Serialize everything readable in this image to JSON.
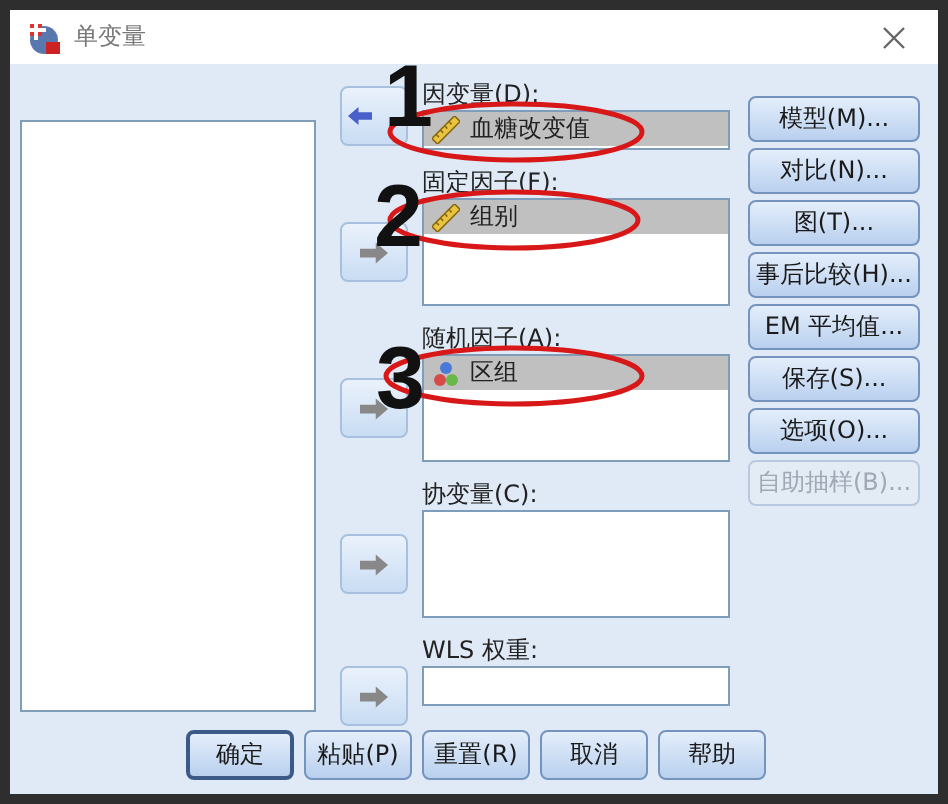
{
  "window": {
    "title": "单变量"
  },
  "groups": [
    {
      "label": "因变量(D):",
      "kind": "single",
      "arrow": {
        "kind": "left",
        "disabled": false
      },
      "items": [
        {
          "name": "血糖改变值",
          "kind": "scale",
          "selected": true
        }
      ]
    },
    {
      "label": "固定因子(F):",
      "kind": "list",
      "arrow": {
        "kind": "right",
        "disabled": true
      },
      "items": [
        {
          "name": "组别",
          "kind": "scale",
          "selected": true
        }
      ]
    },
    {
      "label": "随机因子(A):",
      "kind": "list",
      "arrow": {
        "kind": "right",
        "disabled": true
      },
      "items": [
        {
          "name": "区组",
          "kind": "nominal",
          "selected": true
        }
      ]
    },
    {
      "label": "协变量(C):",
      "kind": "list",
      "arrow": {
        "kind": "right",
        "disabled": true
      }
    },
    {
      "label": "WLS 权重:",
      "kind": "single",
      "arrow": {
        "kind": "right",
        "disabled": true
      }
    }
  ],
  "side_buttons": [
    {
      "label": "模型(M)...",
      "disabled": false
    },
    {
      "label": "对比(N)...",
      "disabled": false
    },
    {
      "label": "图(T)...",
      "disabled": false
    },
    {
      "label": "事后比较(H)...",
      "disabled": false
    },
    {
      "label": "EM 平均值...",
      "disabled": false
    },
    {
      "label": "保存(S)...",
      "disabled": false
    },
    {
      "label": "选项(O)...",
      "disabled": false
    },
    {
      "label": "自助抽样(B)...",
      "disabled": true
    }
  ],
  "bottom_buttons": [
    {
      "label": "确定",
      "default": true
    },
    {
      "label": "粘贴(P)",
      "default": false
    },
    {
      "label": "重置(R)",
      "default": false
    },
    {
      "label": "取消",
      "default": false
    },
    {
      "label": "帮助",
      "default": false
    }
  ],
  "annotations": [
    {
      "number": "1"
    },
    {
      "number": "2"
    },
    {
      "number": "3"
    }
  ]
}
